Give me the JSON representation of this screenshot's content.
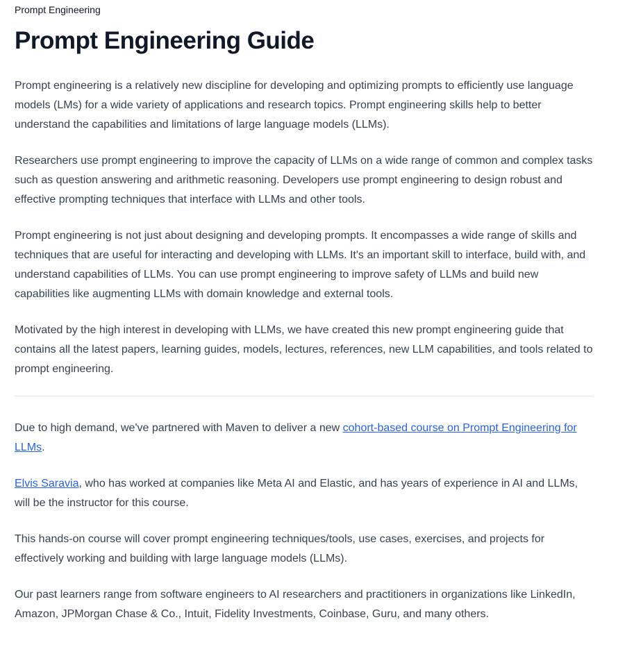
{
  "breadcrumb": "Prompt Engineering",
  "title": "Prompt Engineering Guide",
  "intro": [
    "Prompt engineering is a relatively new discipline for developing and optimizing prompts to efficiently use language models (LMs) for a wide variety of applications and research topics. Prompt engineering skills help to better understand the capabilities and limitations of large language models (LLMs).",
    "Researchers use prompt engineering to improve the capacity of LLMs on a wide range of common and complex tasks such as question answering and arithmetic reasoning. Developers use prompt engineering to design robust and effective prompting techniques that interface with LLMs and other tools.",
    "Prompt engineering is not just about designing and developing prompts. It encompasses a wide range of skills and techniques that are useful for interacting and developing with LLMs. It's an important skill to interface, build with, and understand capabilities of LLMs. You can use prompt engineering to improve safety of LLMs and build new capabilities like augmenting LLMs with domain knowledge and external tools.",
    "Motivated by the high interest in developing with LLMs, we have created this new prompt engineering guide that contains all the latest papers, learning guides, models, lectures, references, new LLM capabilities, and tools related to prompt engineering."
  ],
  "course": {
    "before": "Due to high demand, we've partnered with Maven to deliver a new ",
    "link": "cohort-based course on Prompt Engineering for LLMs",
    "after": "."
  },
  "instructor": {
    "link": "Elvis Saravia",
    "after": ", who has worked at companies like Meta AI and Elastic, and has years of experience in AI and LLMs, will be the instructor for this course."
  },
  "outro": [
    "This hands-on course will cover prompt engineering techniques/tools, use cases, exercises, and projects for effectively working and building with large language models (LLMs).",
    "Our past learners range from software engineers to AI researchers and practitioners in organizations like LinkedIn, Amazon, JPMorgan Chase & Co., Intuit, Fidelity Investments, Coinbase, Guru, and many others."
  ],
  "colors": {
    "link": "#2563eb",
    "heading": "#111827",
    "body": "#374151",
    "divider": "#e5e7eb"
  }
}
